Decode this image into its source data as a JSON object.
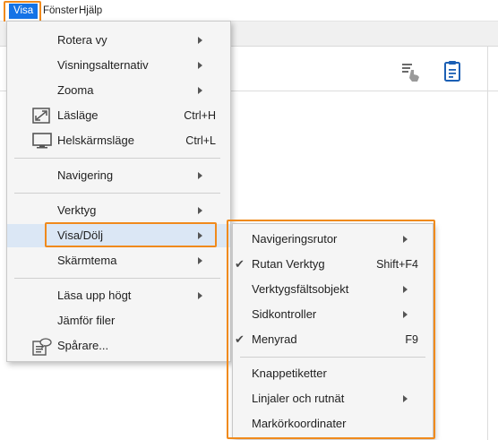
{
  "menubar": {
    "items": [
      "Visa",
      "Fönster",
      "Hjälp"
    ]
  },
  "main_menu": {
    "items": [
      {
        "label": "Rotera vy",
        "shortcut": "",
        "submenu": true
      },
      {
        "label": "Visningsalternativ",
        "shortcut": "",
        "submenu": true
      },
      {
        "label": "Zooma",
        "shortcut": "",
        "submenu": true
      },
      {
        "label": "Läsläge",
        "shortcut": "Ctrl+H",
        "submenu": false,
        "icon": "expand-icon"
      },
      {
        "label": "Helskärmsläge",
        "shortcut": "Ctrl+L",
        "submenu": false,
        "icon": "monitor-icon"
      },
      {
        "label": "Navigering",
        "shortcut": "",
        "submenu": true
      },
      {
        "label": "Verktyg",
        "shortcut": "",
        "submenu": true
      },
      {
        "label": "Visa/Dölj",
        "shortcut": "",
        "submenu": true,
        "active": true
      },
      {
        "label": "Skärmtema",
        "shortcut": "",
        "submenu": true
      },
      {
        "label": "Läsa upp högt",
        "shortcut": "",
        "submenu": true
      },
      {
        "label": "Jämför filer",
        "shortcut": "",
        "submenu": false
      },
      {
        "label": "Spårare...",
        "shortcut": "",
        "submenu": false,
        "icon": "tracker-icon"
      }
    ]
  },
  "sub_menu": {
    "items": [
      {
        "label": "Navigeringsrutor",
        "shortcut": "",
        "submenu": true,
        "checked": false
      },
      {
        "label": "Rutan Verktyg",
        "shortcut": "Shift+F4",
        "submenu": false,
        "checked": true
      },
      {
        "label": "Verktygsfältsobjekt",
        "shortcut": "",
        "submenu": true,
        "checked": false
      },
      {
        "label": "Sidkontroller",
        "shortcut": "",
        "submenu": true,
        "checked": false
      },
      {
        "label": "Menyrad",
        "shortcut": "F9",
        "submenu": false,
        "checked": true
      },
      {
        "label": "Knappetiketter",
        "shortcut": "",
        "submenu": false,
        "checked": false
      },
      {
        "label": "Linjaler och rutnät",
        "shortcut": "",
        "submenu": true,
        "checked": false
      },
      {
        "label": "Markörkoordinater",
        "shortcut": "",
        "submenu": false,
        "checked": false
      }
    ],
    "check_glyph": "✔"
  },
  "colors": {
    "highlight_orange": "#f08a1c",
    "menu_bg": "#f5f5f5",
    "active_item_bg": "#dbe7f5",
    "visa_accent": "#1473e6"
  }
}
